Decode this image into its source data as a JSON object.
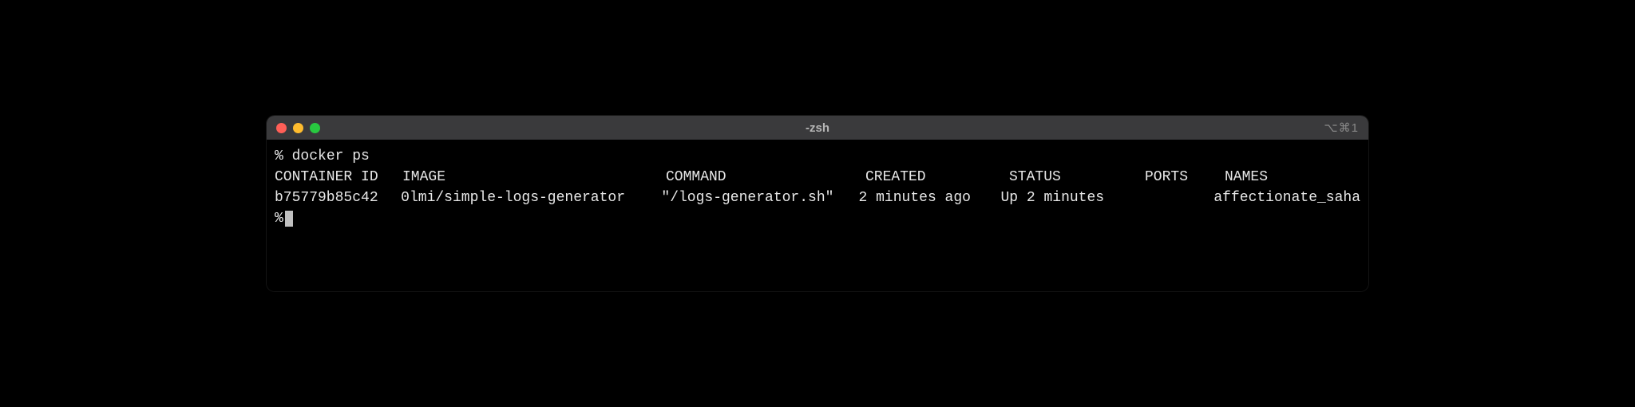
{
  "window": {
    "title": "-zsh",
    "pane_indicator": "⌥⌘1"
  },
  "terminal": {
    "prompt": "%",
    "command": "docker ps",
    "headers": {
      "container_id": "CONTAINER ID",
      "image": "IMAGE",
      "command": "COMMAND",
      "created": "CREATED",
      "status": "STATUS",
      "ports": "PORTS",
      "names": "NAMES"
    },
    "rows": [
      {
        "container_id": "b75779b85c42",
        "image": "0lmi/simple-logs-generator",
        "command": "\"/logs-generator.sh\"",
        "created": "2 minutes ago",
        "status": "Up 2 minutes",
        "ports": "",
        "names": "affectionate_saha"
      }
    ]
  }
}
